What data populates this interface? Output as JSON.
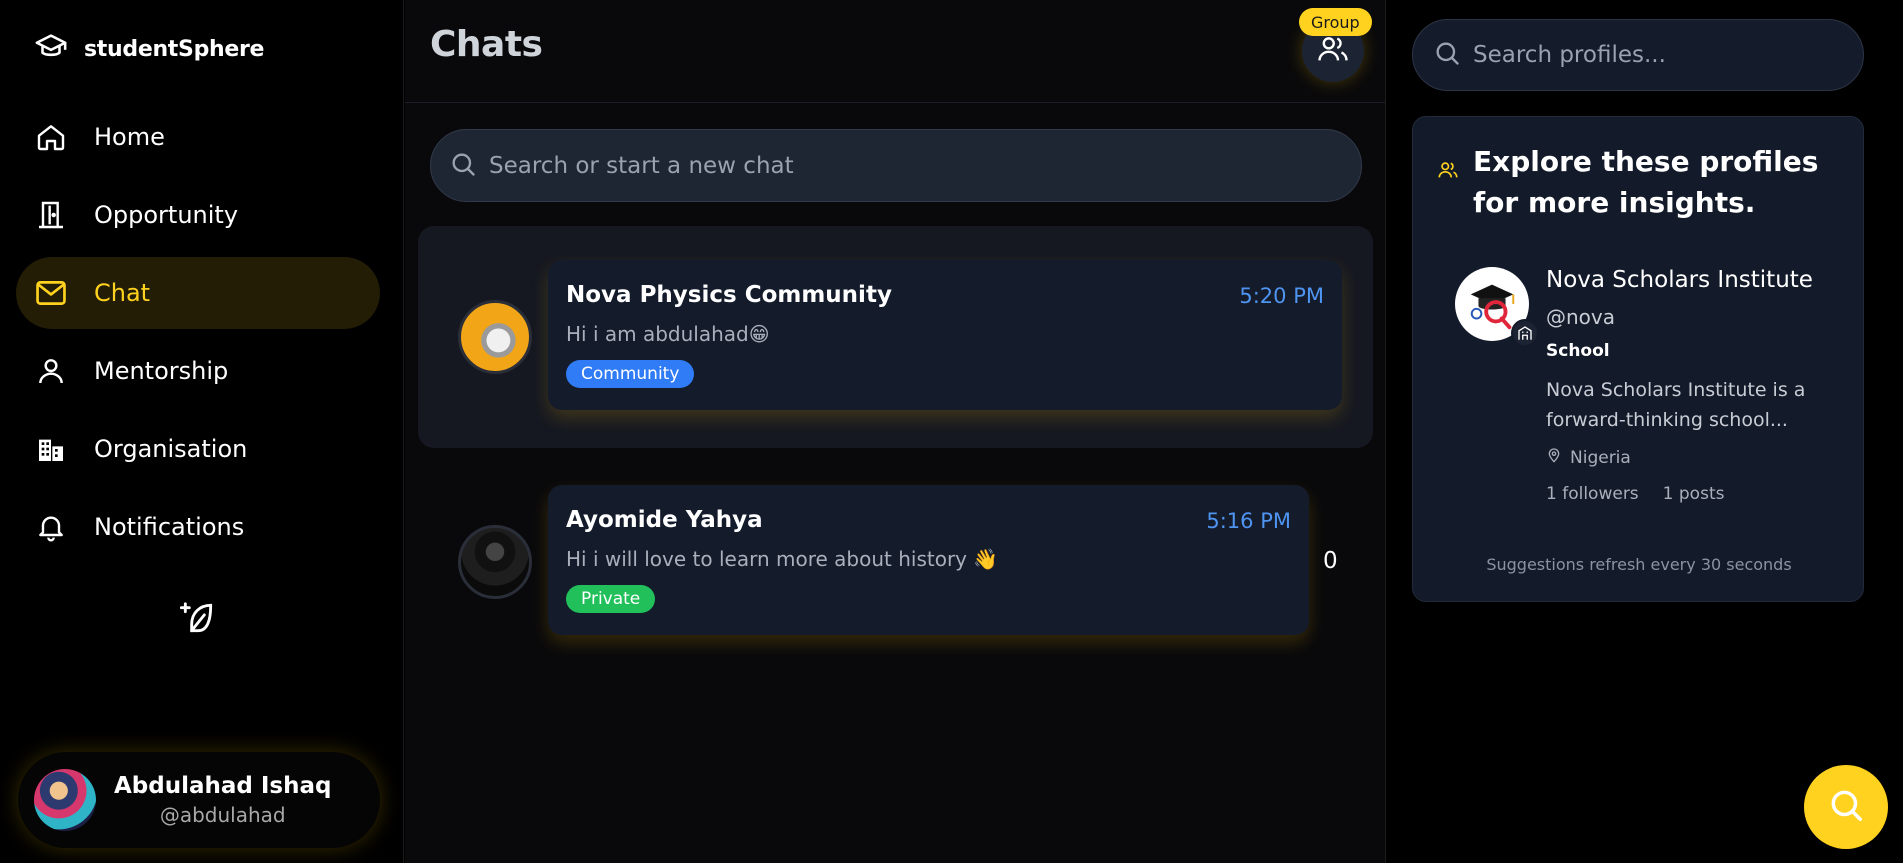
{
  "app": {
    "brand": "studentSphere"
  },
  "sidebar": {
    "items": [
      {
        "label": "Home",
        "icon": "home-icon"
      },
      {
        "label": "Opportunity",
        "icon": "door-icon"
      },
      {
        "label": "Chat",
        "icon": "mail-icon",
        "active": true
      },
      {
        "label": "Mentorship",
        "icon": "user-icon"
      },
      {
        "label": "Organisation",
        "icon": "building-icon"
      },
      {
        "label": "Notifications",
        "icon": "bell-icon"
      }
    ],
    "compose_icon": "feather-plus-icon"
  },
  "user": {
    "name": "Abdulahad Ishaq",
    "handle": "@abdulahad"
  },
  "chats": {
    "title": "Chats",
    "group_badge": "Group",
    "search_placeholder": "Search or start a new chat",
    "items": [
      {
        "name": "Nova Physics Community",
        "time": "5:20 PM",
        "message": "Hi i am abdulahad😁",
        "tag": "Community"
      },
      {
        "name": "Ayomide Yahya",
        "time": "5:16 PM",
        "message": "Hi i will love to learn more about history 👋",
        "tag": "Private",
        "count": "0"
      }
    ]
  },
  "explore": {
    "search_placeholder": "Search profiles...",
    "title": "Explore these profiles for more insights.",
    "profile": {
      "name": "Nova Scholars Institute",
      "handle": "@nova",
      "type": "School",
      "bio": "Nova Scholars Institute is a forward-thinking school...",
      "location": "Nigeria",
      "followers": "1 followers",
      "posts": "1 posts"
    },
    "refresh_note": "Suggestions refresh every 30 seconds"
  },
  "colors": {
    "accent": "#ffd21f",
    "time": "#4e94f0",
    "community": "#2f7cf6",
    "private": "#21c05b"
  }
}
